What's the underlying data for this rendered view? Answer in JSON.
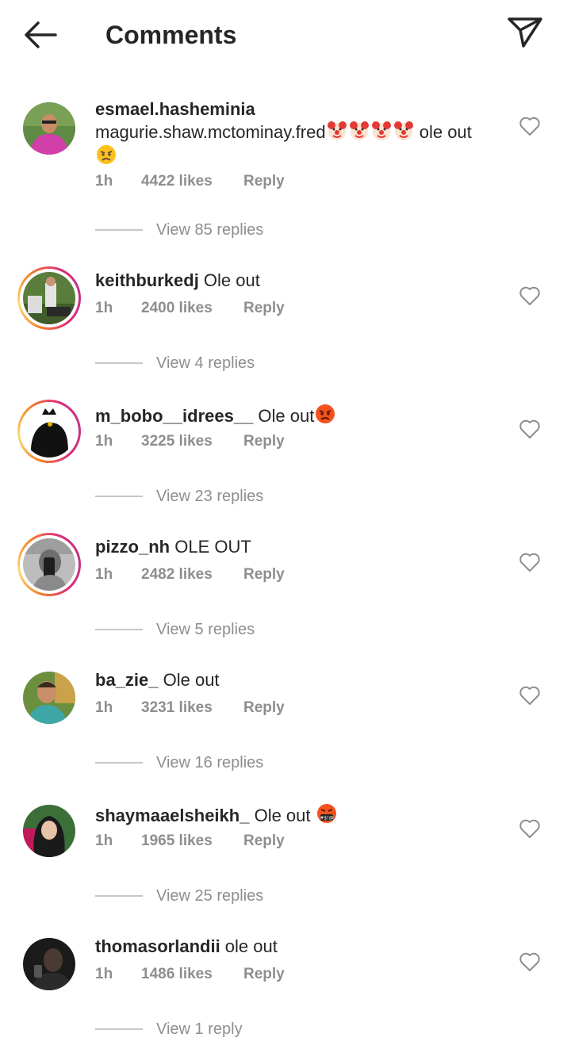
{
  "header": {
    "title": "Comments",
    "back_icon": "arrow-left-icon",
    "send_icon": "paper-plane-icon"
  },
  "comments": [
    {
      "username": "esmael.hasheminia",
      "text": "magurie.shaw.mctominay.fred",
      "text_tail": " ole out",
      "emojis_inline": "clown-face x4",
      "emoji_after": "angry-face",
      "time": "1h",
      "likes": "4422 likes",
      "reply": "Reply",
      "view_replies": "View 85 replies",
      "story_ring": false
    },
    {
      "username": "keithburkedj",
      "text": " Ole out",
      "time": "1h",
      "likes": "2400 likes",
      "reply": "Reply",
      "view_replies": "View 4 replies",
      "story_ring": true
    },
    {
      "username": "m_bobo__idrees__",
      "text": " Ole out",
      "emoji_after": "pouting-face",
      "time": "1h",
      "likes": "3225 likes",
      "reply": "Reply",
      "view_replies": "View 23 replies",
      "story_ring": true
    },
    {
      "username": "pizzo_nh",
      "text": " OLE OUT",
      "time": "1h",
      "likes": "2482 likes",
      "reply": "Reply",
      "view_replies": "View 5 replies",
      "story_ring": true
    },
    {
      "username": "ba_zie_",
      "text": " Ole out",
      "time": "1h",
      "likes": "3231 likes",
      "reply": "Reply",
      "view_replies": "View 16 replies",
      "story_ring": false
    },
    {
      "username": "shaymaaelsheikh_",
      "text": " Ole out ",
      "emoji_after": "face-with-symbols-on-mouth",
      "time": "1h",
      "likes": "1965 likes",
      "reply": "Reply",
      "view_replies": "View 25 replies",
      "story_ring": false
    },
    {
      "username": "thomasorlandii",
      "text": " ole out",
      "time": "1h",
      "likes": "1486 likes",
      "reply": "Reply",
      "view_replies": "View 1 reply",
      "story_ring": false
    }
  ],
  "colors": {
    "text": "#262626",
    "muted": "#8e8e8e",
    "divider": "#c7c7c7",
    "ring_start": "#f58529",
    "ring_end": "#dd2a7b"
  }
}
